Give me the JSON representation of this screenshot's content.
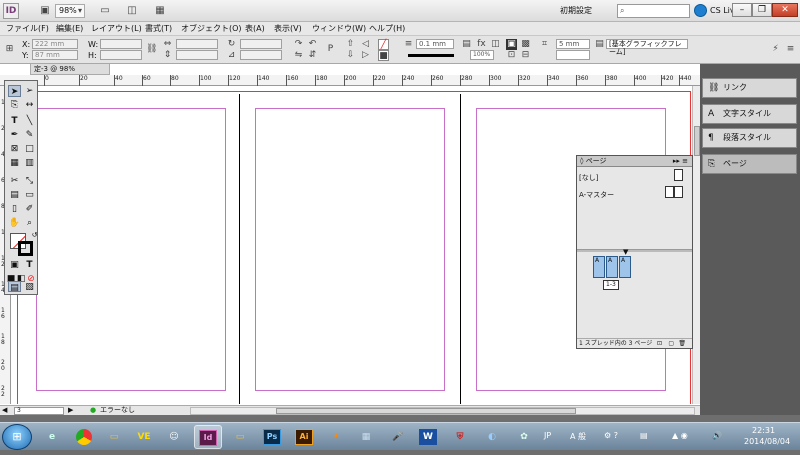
{
  "app": {
    "logo": "ID",
    "zoom": "98%",
    "workspace": "初期設定",
    "search_placeholder": "",
    "cs_live": "CS Live",
    "window_controls": [
      "–",
      "❐",
      "✕"
    ]
  },
  "menu": [
    "ファイル(F)",
    "編集(E)",
    "レイアウト(L)",
    "書式(T)",
    "オブジェクト(O)",
    "表(A)",
    "表示(V)",
    "ウィンドウ(W)",
    "ヘルプ(H)"
  ],
  "control": {
    "x_label": "X:",
    "y_label": "Y:",
    "w_label": "W:",
    "h_label": "H:",
    "x_value": "222 mm",
    "y_value": "87 mm",
    "stroke_weight": "0.1 mm",
    "opacity": "100%",
    "fit_value": "5 mm",
    "object_style": "[基本グラフィックフレーム]"
  },
  "document": {
    "tab_label": "定-3 @ 98%",
    "ruler_ticks": [
      "0",
      "20",
      "40",
      "60",
      "80",
      "100",
      "120",
      "140",
      "160",
      "180",
      "200",
      "220",
      "240",
      "260",
      "280",
      "300",
      "320",
      "340",
      "360",
      "380",
      "400",
      "420",
      "440"
    ],
    "vruler_ticks": [
      "1",
      "2",
      "4",
      "6",
      "8",
      "10",
      "1 2",
      "1 4",
      "1 6",
      "1 8",
      "2 0",
      "2 2"
    ],
    "status": {
      "page": "3",
      "preflight": "エラーなし"
    }
  },
  "dock": {
    "items": [
      {
        "label": "リンク",
        "icon": "link-icon"
      },
      {
        "label": "文字スタイル",
        "icon": "character-style-icon"
      },
      {
        "label": "段落スタイル",
        "icon": "paragraph-style-icon"
      },
      {
        "label": "ページ",
        "icon": "pages-icon"
      }
    ]
  },
  "pages_panel": {
    "title": "ページ",
    "masters": [
      "[なし]",
      "A-マスター"
    ],
    "spread_pages": [
      "A",
      "A",
      "A"
    ],
    "spread_label": "1-3",
    "status": "1 スプレッド内の 3 ページ"
  },
  "taskbar": {
    "time": "22:31",
    "date": "2014/08/04",
    "tray_lang": "JP",
    "tray_ime": "A 般"
  }
}
